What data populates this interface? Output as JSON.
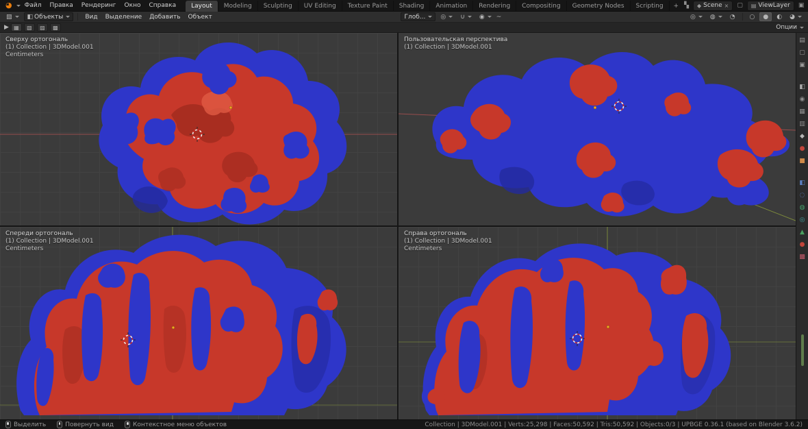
{
  "menubar": {
    "menus": [
      "Файл",
      "Правка",
      "Рендеринг",
      "Окно",
      "Справка"
    ],
    "workspaces": [
      "Layout",
      "Modeling",
      "Sculpting",
      "UV Editing",
      "Texture Paint",
      "Shading",
      "Animation",
      "Rendering",
      "Compositing",
      "Geometry Nodes",
      "Scripting"
    ],
    "add_workspace": "+",
    "scene_label": "Scene",
    "viewlayer_label": "ViewLayer"
  },
  "viewport_header": {
    "mode_label": "Объекты",
    "menus": [
      "Вид",
      "Выделение",
      "Добавить",
      "Объект"
    ],
    "orientation_label": "Глоб...",
    "icons": {
      "editor_type": "▧",
      "mode_cube": "◧",
      "pivot": "◎",
      "snap": "∪",
      "proportional": "◉",
      "falloff": "~",
      "gizmo": "◎",
      "overlays": "◍",
      "xray": "◔",
      "shade_wire": "○",
      "shade_solid": "●",
      "shade_material": "◐",
      "shade_render": "◕"
    }
  },
  "tool_settings": {
    "options_label": "Опции",
    "tool_arrow": "▶",
    "select_modes": [
      {
        "name": "select-new",
        "glyph": "▦"
      },
      {
        "name": "select-extend",
        "glyph": "▧"
      },
      {
        "name": "select-subtract",
        "glyph": "▨"
      },
      {
        "name": "select-intersect",
        "glyph": "▩"
      }
    ]
  },
  "viewports": {
    "top_left": {
      "view": "Сверху ортогональ",
      "breadcrumb": "(1) Collection | 3DModel.001",
      "units": "Centimeters"
    },
    "top_right": {
      "view": "Пользовательская перспектива",
      "breadcrumb": "(1) Collection | 3DModel.001",
      "units": ""
    },
    "bottom_left": {
      "view": "Спереди ортогональ",
      "breadcrumb": "(1) Collection | 3DModel.001",
      "units": "Centimeters"
    },
    "bottom_right": {
      "view": "Справа ортогональ",
      "breadcrumb": "(1) Collection | 3DModel.001",
      "units": "Centimeters"
    }
  },
  "statusbar": {
    "hints": [
      {
        "name": "left-mouse",
        "label": "Выделить"
      },
      {
        "name": "middle-mouse",
        "label": "Повернуть вид"
      },
      {
        "name": "right-mouse",
        "label": "Контекстное меню объектов"
      }
    ],
    "stats": "Collection | 3DModel.001 | Verts:25,298 | Faces:50,592 | Tris:50,592 | Objects:0/3 | UPBGE 0.36.1 (based on Blender 3.6.2)"
  },
  "sidebar": {
    "tabs": [
      {
        "name": "editor-type",
        "glyph": "▤",
        "color": "#9a9a9a"
      },
      {
        "name": "window",
        "glyph": "▢",
        "color": "#9a9a9a"
      },
      {
        "name": "screen",
        "glyph": "▣",
        "color": "#9a9a9a"
      },
      {
        "name": "tool",
        "glyph": "◧",
        "color": "#ababab"
      },
      {
        "name": "render",
        "glyph": "◉",
        "color": "#8f8f8f"
      },
      {
        "name": "output",
        "glyph": "▦",
        "color": "#8f8f8f"
      },
      {
        "name": "view-layer",
        "glyph": "▥",
        "color": "#8f8f8f"
      },
      {
        "name": "scene",
        "glyph": "◆",
        "color": "#b5b5b5"
      },
      {
        "name": "world",
        "glyph": "●",
        "color": "#c1443a"
      },
      {
        "name": "object",
        "glyph": "■",
        "color": "#d08a4a"
      },
      {
        "name": "modifiers",
        "glyph": "◧",
        "color": "#5a7ec0"
      },
      {
        "name": "particles",
        "glyph": "◌",
        "color": "#5a7ec0"
      },
      {
        "name": "physics",
        "glyph": "◍",
        "color": "#44a06a"
      },
      {
        "name": "constraints",
        "glyph": "◎",
        "color": "#44a0a0"
      },
      {
        "name": "data",
        "glyph": "▲",
        "color": "#4aa060"
      },
      {
        "name": "material",
        "glyph": "●",
        "color": "#c1443a"
      },
      {
        "name": "texture",
        "glyph": "▩",
        "color": "#c15a6a"
      }
    ]
  },
  "colors": {
    "model_red": "#c7382a",
    "model_blue": "#2e36c9",
    "axis_red": "#a85050",
    "axis_green": "#8a9a3c"
  }
}
